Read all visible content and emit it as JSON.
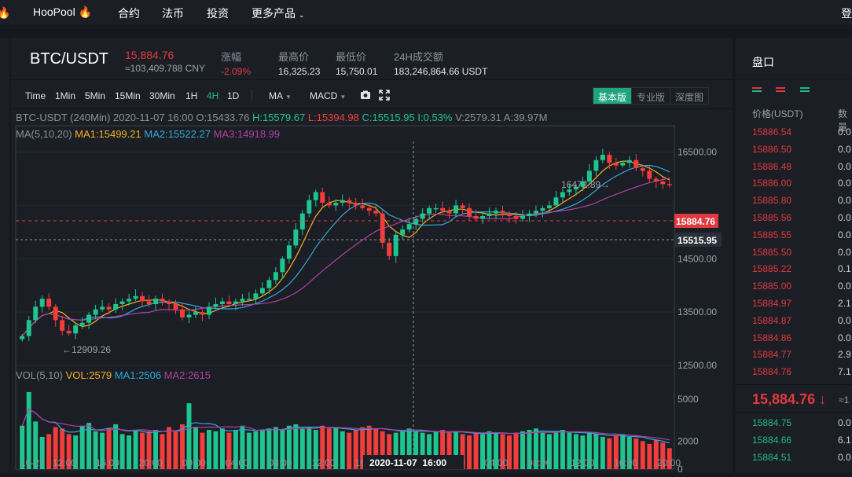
{
  "nav": {
    "brand": "HooPool",
    "items": [
      "合约",
      "法币",
      "投资",
      "更多产品"
    ],
    "login": "登"
  },
  "ticker": {
    "pair": "BTC/USDT",
    "price": "15,884.76",
    "cny": "≈103,409.788 CNY",
    "stats": [
      {
        "label": "涨幅",
        "value": "-2.09%",
        "color": "red"
      },
      {
        "label": "最高价",
        "value": "16,325.23",
        "color": "white"
      },
      {
        "label": "最低价",
        "value": "15,750.01",
        "color": "white"
      },
      {
        "label": "24H成交额",
        "value": "183,246,864.66 USDT",
        "color": "white"
      }
    ]
  },
  "toolbar": {
    "timeframes": [
      "Time",
      "1Min",
      "5Min",
      "15Min",
      "30Min",
      "1H",
      "4H",
      "1D"
    ],
    "active_timeframe": "4H",
    "indicators": [
      "MA",
      "MACD"
    ],
    "modes": [
      "基本版",
      "专业版",
      "深度图"
    ],
    "active_mode": "基本版",
    "icons": [
      "camera-icon",
      "fullscreen-icon"
    ]
  },
  "chart": {
    "info": {
      "symbol": "BTC-USDT",
      "period": "(240Min)",
      "date": "2020-11-07",
      "time": "16:00",
      "open": "O:15433.76",
      "high": "H:15579.67",
      "low": "L:15394.98",
      "close": "C:15515.95",
      "inc": "I:0.53%",
      "vol": "V:2579.31",
      "amt": "A:39.97M"
    },
    "ma": {
      "label": "MA(5,10,20)",
      "ma1": "MA1:15499.21",
      "ma2": "MA2:15522.27",
      "ma3": "MA3:14918.99"
    },
    "vol": {
      "label": "VOL(5,10)",
      "vol": "VOL:2579",
      "ma1": "MA1:2506",
      "ma2": "MA2:2615"
    },
    "max_label": "16472.89→",
    "min_label": "←12909.26",
    "last_price_tag": "15884.76",
    "cursor_price_tag": "15515.95",
    "cursor_time_tag": "2020-11-07  16:00",
    "price_ticks": [
      "16500.00",
      "14500.00",
      "13500.00",
      "12500.00"
    ],
    "vol_ticks": [
      "5000",
      "2000",
      "0"
    ],
    "time_ticks": [
      "10-27",
      "12:00",
      "16:00",
      "20:00",
      "00:00",
      "04:00",
      "08:00",
      "12:00",
      "16:00",
      "20:00",
      "00:00",
      "04:00",
      "08:00",
      "12:00",
      "16:00",
      "20:00"
    ],
    "colors": {
      "up": "#1fc58f",
      "down": "#f23d3d",
      "ma1": "#f2b01e",
      "ma2": "#2fa7d8",
      "ma3": "#b23fa3"
    }
  },
  "chart_data": {
    "type": "candlestick",
    "timeframe": "4H",
    "ylim": [
      12500,
      16700
    ],
    "close_trend": [
      13050,
      13350,
      13600,
      13750,
      13600,
      13350,
      13150,
      13100,
      13250,
      13300,
      13450,
      13550,
      13600,
      13550,
      13650,
      13700,
      13750,
      13800,
      13700,
      13650,
      13750,
      13700,
      13650,
      13550,
      13400,
      13450,
      13500,
      13450,
      13600,
      13650,
      13700,
      13650,
      13700,
      13750,
      13750,
      13850,
      13950,
      14100,
      14250,
      14500,
      14750,
      15050,
      15350,
      15600,
      15750,
      15550,
      15500,
      15550,
      15600,
      15550,
      15500,
      15450,
      15400,
      15350,
      14800,
      14550,
      14950,
      15050,
      15150,
      15250,
      15350,
      15450,
      15450,
      15400,
      15350,
      15500,
      15450,
      15300,
      15250,
      15300,
      15350,
      15400,
      15350,
      15300,
      15250,
      15300,
      15350,
      15400,
      15450,
      15500,
      15650,
      15750,
      15800,
      15850,
      15950,
      16150,
      16350,
      16450,
      16300,
      16250,
      16300,
      16350,
      16200,
      16150,
      16000,
      15950,
      15900,
      15885
    ],
    "volume": [
      3100,
      5500,
      3400,
      2300,
      2500,
      3000,
      2900,
      2500,
      2400,
      3100,
      3300,
      2700,
      2600,
      2900,
      3200,
      2500,
      2400,
      2800,
      2600,
      2700,
      2800,
      2500,
      3000,
      2700,
      3200,
      4700,
      3000,
      2600,
      2800,
      2700,
      2900,
      2600,
      2800,
      3100,
      2600,
      2700,
      2800,
      2900,
      3000,
      2800,
      3100,
      3200,
      2900,
      3000,
      2800,
      3100,
      2900,
      3000,
      2700,
      2600,
      2800,
      3000,
      3100,
      2900,
      2700,
      2500,
      2600,
      2800,
      2900,
      2700,
      2600,
      2500,
      2700,
      2800,
      2600,
      2700,
      2500,
      2400,
      2600,
      2500,
      2700,
      2600,
      2500,
      2400,
      2600,
      2700,
      2800,
      2900,
      2600,
      2500,
      2700,
      2800,
      2600,
      2500,
      2400,
      2600,
      2500,
      2300,
      2200,
      2400,
      2500,
      2300,
      2200,
      2000,
      1800,
      2100,
      1900,
      1500
    ]
  },
  "orderbook": {
    "title": "盘口",
    "col_price": "价格(USDT)",
    "col_amount": "数量",
    "asks": [
      {
        "p": "15886.54",
        "a": "0.0"
      },
      {
        "p": "15886.50",
        "a": "0.0"
      },
      {
        "p": "15886.48",
        "a": "0.0"
      },
      {
        "p": "15886.00",
        "a": "0.0"
      },
      {
        "p": "15885.80",
        "a": "0.0"
      },
      {
        "p": "15885.56",
        "a": "0.0"
      },
      {
        "p": "15885.55",
        "a": "0.0"
      },
      {
        "p": "15885.50",
        "a": "0.0"
      },
      {
        "p": "15885.22",
        "a": "0.1"
      },
      {
        "p": "15885.00",
        "a": "0.0"
      },
      {
        "p": "15884.97",
        "a": "2.1"
      },
      {
        "p": "15884.87",
        "a": "0.0"
      },
      {
        "p": "15884.86",
        "a": "0.0"
      },
      {
        "p": "15884.77",
        "a": "2.9"
      },
      {
        "p": "15884.76",
        "a": "7.1"
      }
    ],
    "mid_price": "15,884.76 ↓",
    "mid_cny": "≈1",
    "bids": [
      {
        "p": "15884.75",
        "a": "0.0"
      },
      {
        "p": "15884.66",
        "a": "6.1"
      },
      {
        "p": "15884.51",
        "a": "0.0"
      }
    ]
  }
}
